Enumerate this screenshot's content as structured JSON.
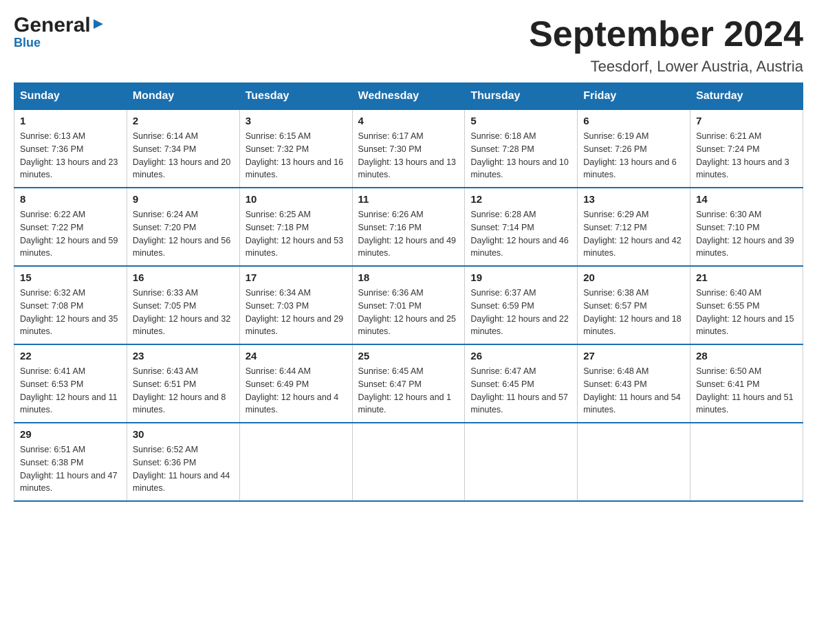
{
  "header": {
    "logo_general": "General",
    "logo_blue": "Blue",
    "title": "September 2024",
    "subtitle": "Teesdorf, Lower Austria, Austria"
  },
  "calendar": {
    "days_of_week": [
      "Sunday",
      "Monday",
      "Tuesday",
      "Wednesday",
      "Thursday",
      "Friday",
      "Saturday"
    ],
    "weeks": [
      [
        {
          "day": "1",
          "sunrise": "6:13 AM",
          "sunset": "7:36 PM",
          "daylight": "13 hours and 23 minutes."
        },
        {
          "day": "2",
          "sunrise": "6:14 AM",
          "sunset": "7:34 PM",
          "daylight": "13 hours and 20 minutes."
        },
        {
          "day": "3",
          "sunrise": "6:15 AM",
          "sunset": "7:32 PM",
          "daylight": "13 hours and 16 minutes."
        },
        {
          "day": "4",
          "sunrise": "6:17 AM",
          "sunset": "7:30 PM",
          "daylight": "13 hours and 13 minutes."
        },
        {
          "day": "5",
          "sunrise": "6:18 AM",
          "sunset": "7:28 PM",
          "daylight": "13 hours and 10 minutes."
        },
        {
          "day": "6",
          "sunrise": "6:19 AM",
          "sunset": "7:26 PM",
          "daylight": "13 hours and 6 minutes."
        },
        {
          "day": "7",
          "sunrise": "6:21 AM",
          "sunset": "7:24 PM",
          "daylight": "13 hours and 3 minutes."
        }
      ],
      [
        {
          "day": "8",
          "sunrise": "6:22 AM",
          "sunset": "7:22 PM",
          "daylight": "12 hours and 59 minutes."
        },
        {
          "day": "9",
          "sunrise": "6:24 AM",
          "sunset": "7:20 PM",
          "daylight": "12 hours and 56 minutes."
        },
        {
          "day": "10",
          "sunrise": "6:25 AM",
          "sunset": "7:18 PM",
          "daylight": "12 hours and 53 minutes."
        },
        {
          "day": "11",
          "sunrise": "6:26 AM",
          "sunset": "7:16 PM",
          "daylight": "12 hours and 49 minutes."
        },
        {
          "day": "12",
          "sunrise": "6:28 AM",
          "sunset": "7:14 PM",
          "daylight": "12 hours and 46 minutes."
        },
        {
          "day": "13",
          "sunrise": "6:29 AM",
          "sunset": "7:12 PM",
          "daylight": "12 hours and 42 minutes."
        },
        {
          "day": "14",
          "sunrise": "6:30 AM",
          "sunset": "7:10 PM",
          "daylight": "12 hours and 39 minutes."
        }
      ],
      [
        {
          "day": "15",
          "sunrise": "6:32 AM",
          "sunset": "7:08 PM",
          "daylight": "12 hours and 35 minutes."
        },
        {
          "day": "16",
          "sunrise": "6:33 AM",
          "sunset": "7:05 PM",
          "daylight": "12 hours and 32 minutes."
        },
        {
          "day": "17",
          "sunrise": "6:34 AM",
          "sunset": "7:03 PM",
          "daylight": "12 hours and 29 minutes."
        },
        {
          "day": "18",
          "sunrise": "6:36 AM",
          "sunset": "7:01 PM",
          "daylight": "12 hours and 25 minutes."
        },
        {
          "day": "19",
          "sunrise": "6:37 AM",
          "sunset": "6:59 PM",
          "daylight": "12 hours and 22 minutes."
        },
        {
          "day": "20",
          "sunrise": "6:38 AM",
          "sunset": "6:57 PM",
          "daylight": "12 hours and 18 minutes."
        },
        {
          "day": "21",
          "sunrise": "6:40 AM",
          "sunset": "6:55 PM",
          "daylight": "12 hours and 15 minutes."
        }
      ],
      [
        {
          "day": "22",
          "sunrise": "6:41 AM",
          "sunset": "6:53 PM",
          "daylight": "12 hours and 11 minutes."
        },
        {
          "day": "23",
          "sunrise": "6:43 AM",
          "sunset": "6:51 PM",
          "daylight": "12 hours and 8 minutes."
        },
        {
          "day": "24",
          "sunrise": "6:44 AM",
          "sunset": "6:49 PM",
          "daylight": "12 hours and 4 minutes."
        },
        {
          "day": "25",
          "sunrise": "6:45 AM",
          "sunset": "6:47 PM",
          "daylight": "12 hours and 1 minute."
        },
        {
          "day": "26",
          "sunrise": "6:47 AM",
          "sunset": "6:45 PM",
          "daylight": "11 hours and 57 minutes."
        },
        {
          "day": "27",
          "sunrise": "6:48 AM",
          "sunset": "6:43 PM",
          "daylight": "11 hours and 54 minutes."
        },
        {
          "day": "28",
          "sunrise": "6:50 AM",
          "sunset": "6:41 PM",
          "daylight": "11 hours and 51 minutes."
        }
      ],
      [
        {
          "day": "29",
          "sunrise": "6:51 AM",
          "sunset": "6:38 PM",
          "daylight": "11 hours and 47 minutes."
        },
        {
          "day": "30",
          "sunrise": "6:52 AM",
          "sunset": "6:36 PM",
          "daylight": "11 hours and 44 minutes."
        },
        null,
        null,
        null,
        null,
        null
      ]
    ],
    "labels": {
      "sunrise": "Sunrise:",
      "sunset": "Sunset:",
      "daylight": "Daylight:"
    }
  }
}
